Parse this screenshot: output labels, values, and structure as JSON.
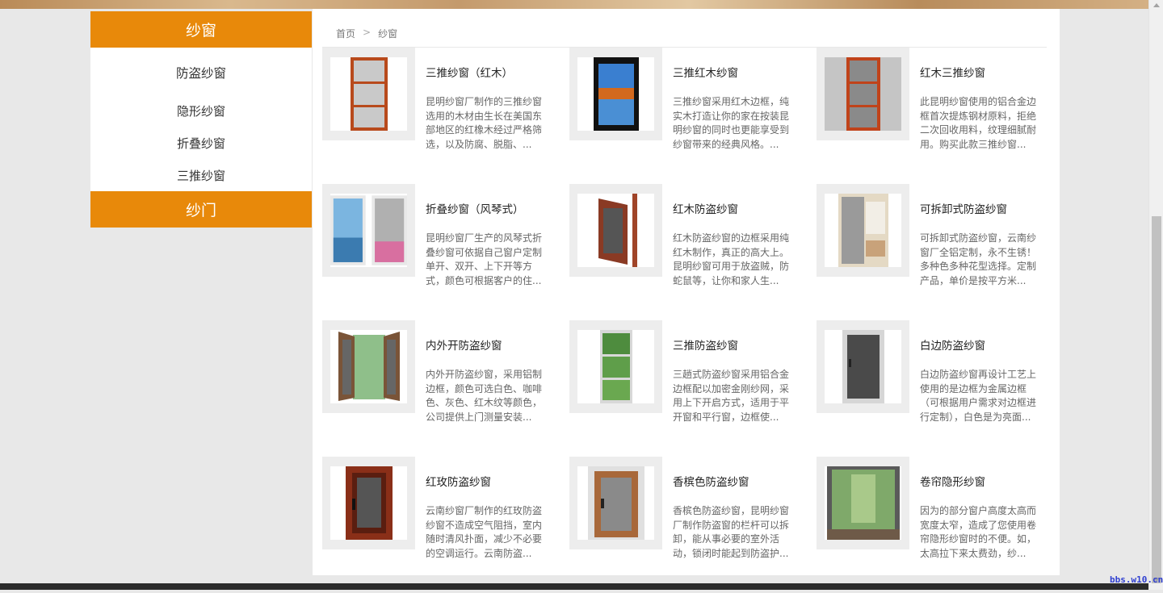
{
  "sidebar": {
    "section1_title": "纱窗",
    "items": [
      {
        "label": "防盗纱窗"
      },
      {
        "label": "隐形纱窗"
      },
      {
        "label": "折叠纱窗"
      },
      {
        "label": "三推纱窗"
      }
    ],
    "section2_title": "纱门"
  },
  "breadcrumb": {
    "home": "首页",
    "separator": ">",
    "current": "纱窗"
  },
  "products": [
    {
      "title": "三推纱窗（红木）",
      "desc": "昆明纱窗厂制作的三推纱窗选用的木材由生长在美国东部地区的红橡木经过严格筛选，以及防腐、脱脂、...",
      "image": "red-frame-triple-window"
    },
    {
      "title": "三推红木纱窗",
      "desc": "三推纱窗采用红木边框，纯实木打造让你的家在按装昆明纱窗的同时也更能享受到纱窗带来的经典风格。...",
      "image": "landscape-window"
    },
    {
      "title": "红木三推纱窗",
      "desc": "此昆明纱窗使用的铝合金边框首次提炼钢材原料，拒绝二次回收用料，纹理细腻耐用。购买此款三推纱窗...",
      "image": "red-mesh-window"
    },
    {
      "title": "折叠纱窗（风琴式）",
      "desc": "昆明纱窗厂生产的风琴式折叠纱窗可依据自己窗户定制单开、双开、上下开等方式，颜色可根据客户的住...",
      "image": "folding-lake-window"
    },
    {
      "title": "红木防盗纱窗",
      "desc": "红木防盗纱窗的边框采用纯红木制作，真正的高大上。昆明纱窗可用于放盗贼，防蛇鼠等，让你和家人生...",
      "image": "open-red-sash"
    },
    {
      "title": "可拆卸式防盗纱窗",
      "desc": "可拆卸式防盗纱窗，云南纱窗厂全铝定制，永不生锈！多种色多种花型选择。定制产品，单价是按平方米...",
      "image": "room-view-door"
    },
    {
      "title": "内外开防盗纱窗",
      "desc": "内外开防盗纱窗，采用铝制边框，颜色可选白色、咖啡色、灰色、红木纹等颜色，公司提供上门测量安装...",
      "image": "double-open-window"
    },
    {
      "title": "三推防盗纱窗",
      "desc": "三趟式防盗纱窗采用铝合金边框配以加密金刚纱网，采用上下开启方式，适用于平开窗和平行窗，边框使...",
      "image": "forest-window"
    },
    {
      "title": "白边防盗纱窗",
      "desc": "白边防盗纱窗再设计工艺上使用的是边框为金属边框（可根据用户需求对边框进行定制），白色是为亮面...",
      "image": "white-frame-screen"
    },
    {
      "title": "红玫防盗纱窗",
      "desc": "云南纱窗厂制作的红玫防盗纱窗不造成空气阻挡，室内随时清风扑面，减少不必要的空调运行。云南防盗...",
      "image": "red-rose-door"
    },
    {
      "title": "香槟色防盗纱窗",
      "desc": "香槟色防盗纱窗，昆明纱窗厂制作防盗窗的栏杆可以拆卸，能从事必要的室外活动，锁闭时能起到防盗护...",
      "image": "champagne-door"
    },
    {
      "title": "卷帘隐形纱窗",
      "desc": "因为的部分窗户高度太高而宽度太窄，造成了您使用卷帘隐形纱窗时的不便。如，太高拉下来太费劲，纱...",
      "image": "garden-window"
    }
  ],
  "watermark": "bbs.w10.cn",
  "colors": {
    "accent": "#e8890a"
  }
}
